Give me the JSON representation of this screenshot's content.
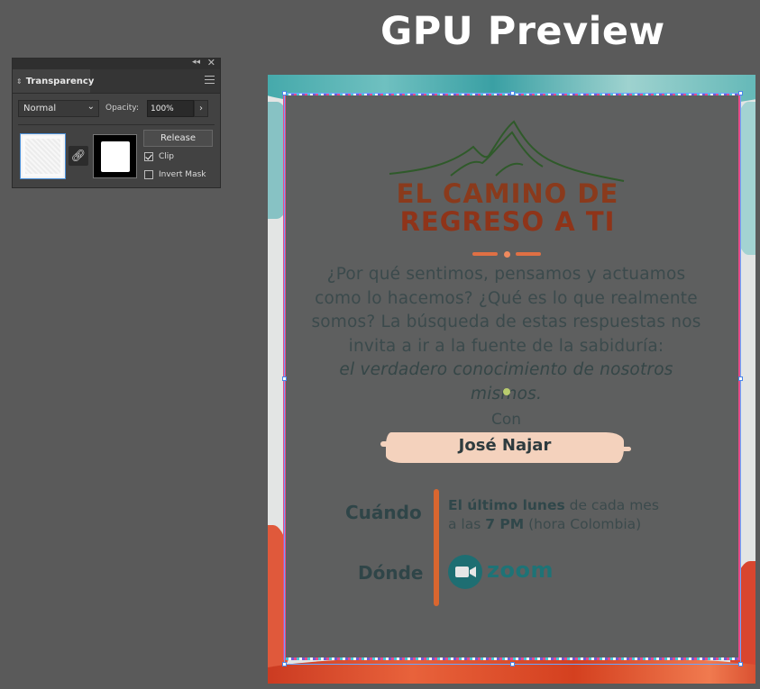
{
  "window_title": "GPU Preview",
  "transparency_panel": {
    "tab_label": "Transparency",
    "blend_mode": "Normal",
    "opacity_label": "Opacity:",
    "opacity_value": "100%",
    "release_label": "Release",
    "clip_label": "Clip",
    "clip_checked": true,
    "invert_mask_label": "Invert Mask",
    "invert_mask_checked": false
  },
  "poster": {
    "title_line1": "EL CAMINO DE",
    "title_line2": "REGRESO A TI",
    "paragraph_lines": [
      "¿Por qué sentimos, pensamos y actuamos",
      "como lo hacemos? ¿Qué es lo que realmente",
      "somos? La búsqueda de estas respuestas nos",
      "invita a ir a la fuente de la sabiduría:"
    ],
    "paragraph_emphasis": "el verdadero conocimiento de nosotros mismos.",
    "con_label": "Con",
    "host_name": "José Najar",
    "when_label": "Cuándo",
    "when_bold": "El último lunes",
    "when_rest": " de cada mes",
    "when_line2_pre": "a las ",
    "when_time": "7 PM",
    "when_line2_post": " (hora Colombia)",
    "where_label": "Dónde",
    "where_value": "zoom"
  },
  "colors": {
    "panel_bg": "#424242",
    "title_brown": "#8a3a1c",
    "accent_orange": "#d9662f",
    "zoom_teal": "#1e7376"
  }
}
